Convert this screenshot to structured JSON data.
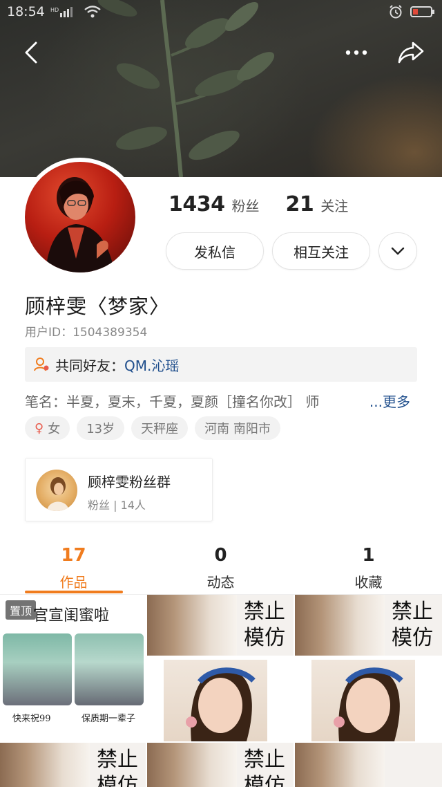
{
  "status_bar": {
    "time": "18:54",
    "signal_label": "HD"
  },
  "nav": {
    "back_icon": "chevron-left-icon",
    "more_icon": "more-horizontal-icon",
    "share_icon": "share-icon"
  },
  "profile": {
    "fans_count": "1434",
    "fans_label": "粉丝",
    "following_count": "21",
    "following_label": "关注",
    "message_button": "发私信",
    "mutual_button": "相互关注",
    "name": "顾梓雯〈梦家〉",
    "user_id": "用户ID：1504389354",
    "common_friends_label": "共同好友：",
    "common_friend_name": "QM.沁瑶",
    "bio": "笔名：半夏，夏末，千夏，夏颜［撞名你改］ 师",
    "bio_more": "...更多",
    "tags": {
      "gender": "女",
      "age": "13岁",
      "zodiac": "天秤座",
      "location": "河南 南阳市"
    }
  },
  "fan_group": {
    "title": "顾梓雯粉丝群",
    "subtitle": "粉丝 | 14人"
  },
  "tabs": [
    {
      "count": "17",
      "label": "作品",
      "active": true
    },
    {
      "count": "0",
      "label": "动态",
      "active": false
    },
    {
      "count": "1",
      "label": "收藏",
      "active": false
    }
  ],
  "grid": {
    "pinned_label": "置顶",
    "post1_title": "官宣闺蜜啦",
    "post1_caption_left": "快来祝99",
    "post1_caption_right": "保质期一辈子",
    "repost_text_line1": "禁止",
    "repost_text_line2": "模仿"
  },
  "colors": {
    "accent": "#f07c1e",
    "link": "#1f4e8c"
  }
}
